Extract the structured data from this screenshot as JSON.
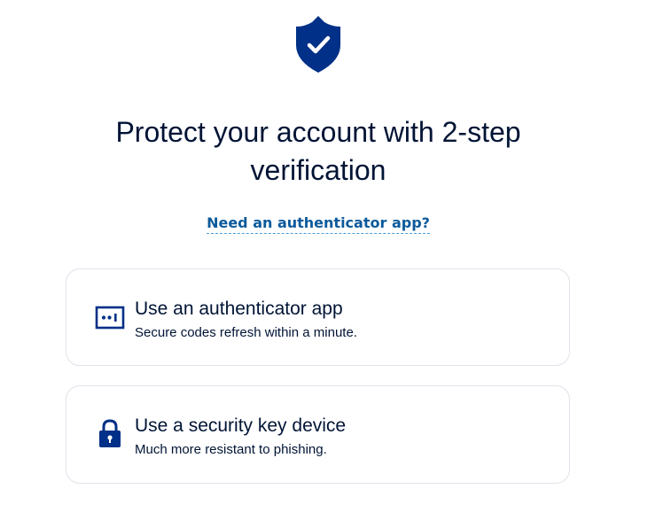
{
  "header": {
    "icon": "shield-check-icon",
    "title": "Protect your account with 2-step verification",
    "help_link": "Need an authenticator app?"
  },
  "colors": {
    "brand_navy": "#003087",
    "text": "#001435",
    "link": "#0b5a9b"
  },
  "options": [
    {
      "icon": "authenticator-app-icon",
      "title": "Use an authenticator app",
      "description": "Secure codes refresh within a minute."
    },
    {
      "icon": "padlock-icon",
      "title": "Use a security key device",
      "description": "Much more resistant to phishing."
    }
  ]
}
